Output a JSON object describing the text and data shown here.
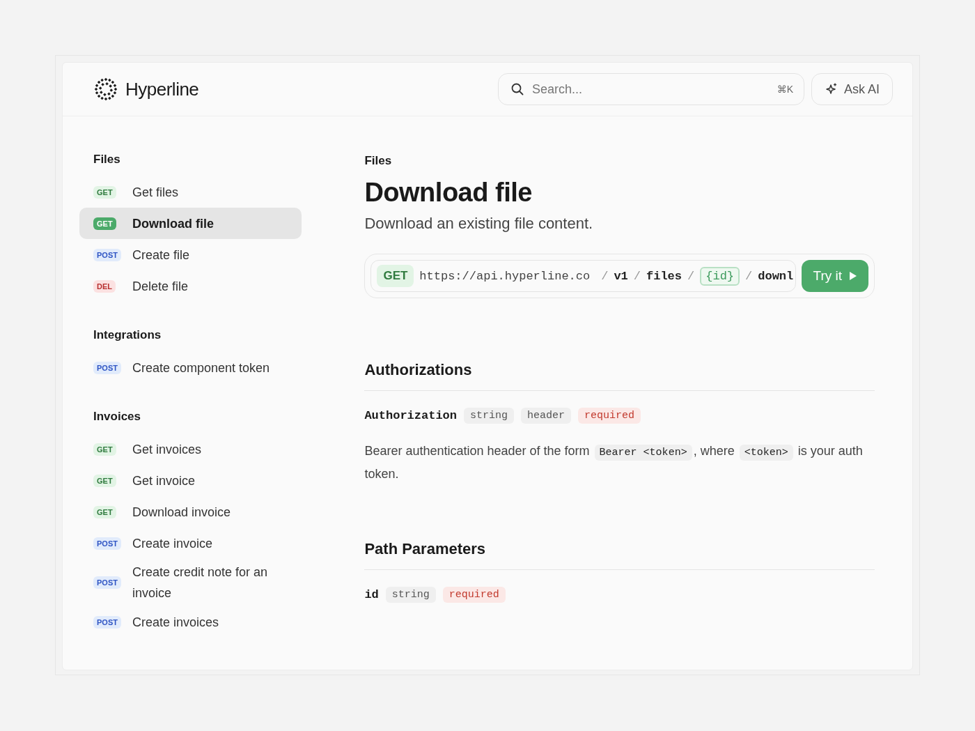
{
  "header": {
    "brand": "Hyperline",
    "search": {
      "placeholder": "Search...",
      "shortcut": "⌘K"
    },
    "ask_button": "Ask AI"
  },
  "sidebar": {
    "groups": [
      {
        "title": "Files",
        "items": [
          {
            "method": "GET",
            "kind": "get",
            "label": "Get files",
            "selected": false
          },
          {
            "method": "GET",
            "kind": "get",
            "label": "Download file",
            "selected": true
          },
          {
            "method": "POST",
            "kind": "post",
            "label": "Create file",
            "selected": false
          },
          {
            "method": "DEL",
            "kind": "del",
            "label": "Delete file",
            "selected": false
          }
        ]
      },
      {
        "title": "Integrations",
        "items": [
          {
            "method": "POST",
            "kind": "post",
            "label": "Create component token",
            "selected": false
          }
        ]
      },
      {
        "title": "Invoices",
        "items": [
          {
            "method": "GET",
            "kind": "get",
            "label": "Get invoices",
            "selected": false
          },
          {
            "method": "GET",
            "kind": "get",
            "label": "Get invoice",
            "selected": false
          },
          {
            "method": "GET",
            "kind": "get",
            "label": "Download invoice",
            "selected": false
          },
          {
            "method": "POST",
            "kind": "post",
            "label": "Create invoice",
            "selected": false
          },
          {
            "method": "POST",
            "kind": "post",
            "label": "Create credit note for an invoice",
            "selected": false
          },
          {
            "method": "POST",
            "kind": "post",
            "label": "Create invoices",
            "selected": false
          }
        ]
      }
    ]
  },
  "content": {
    "eyebrow": "Files",
    "title": "Download file",
    "description": "Download an existing file content.",
    "endpoint": {
      "method": "GET",
      "base_url": "https://api.hyperline.co",
      "segments": [
        {
          "separator": "/",
          "text": "v1",
          "kind": "plain"
        },
        {
          "separator": "/",
          "text": "files",
          "kind": "plain"
        },
        {
          "separator": "/",
          "text": "{id}",
          "kind": "param"
        },
        {
          "separator": "/",
          "text": "downl",
          "kind": "plain"
        }
      ],
      "try_button": "Try it"
    },
    "sections": [
      {
        "title": "Authorizations",
        "fields": [
          {
            "name": "Authorization",
            "type": "string",
            "location": "header",
            "required": "required",
            "description": [
              {
                "kind": "text",
                "text": "Bearer authentication header of the form "
              },
              {
                "kind": "code",
                "text": "Bearer <token>"
              },
              {
                "kind": "text",
                "text": ", where "
              },
              {
                "kind": "code",
                "text": "<token>"
              },
              {
                "kind": "text",
                "text": " is your auth token."
              }
            ]
          }
        ]
      },
      {
        "title": "Path Parameters",
        "fields": [
          {
            "name": "id",
            "type": "string",
            "required": "required"
          }
        ]
      }
    ]
  }
}
